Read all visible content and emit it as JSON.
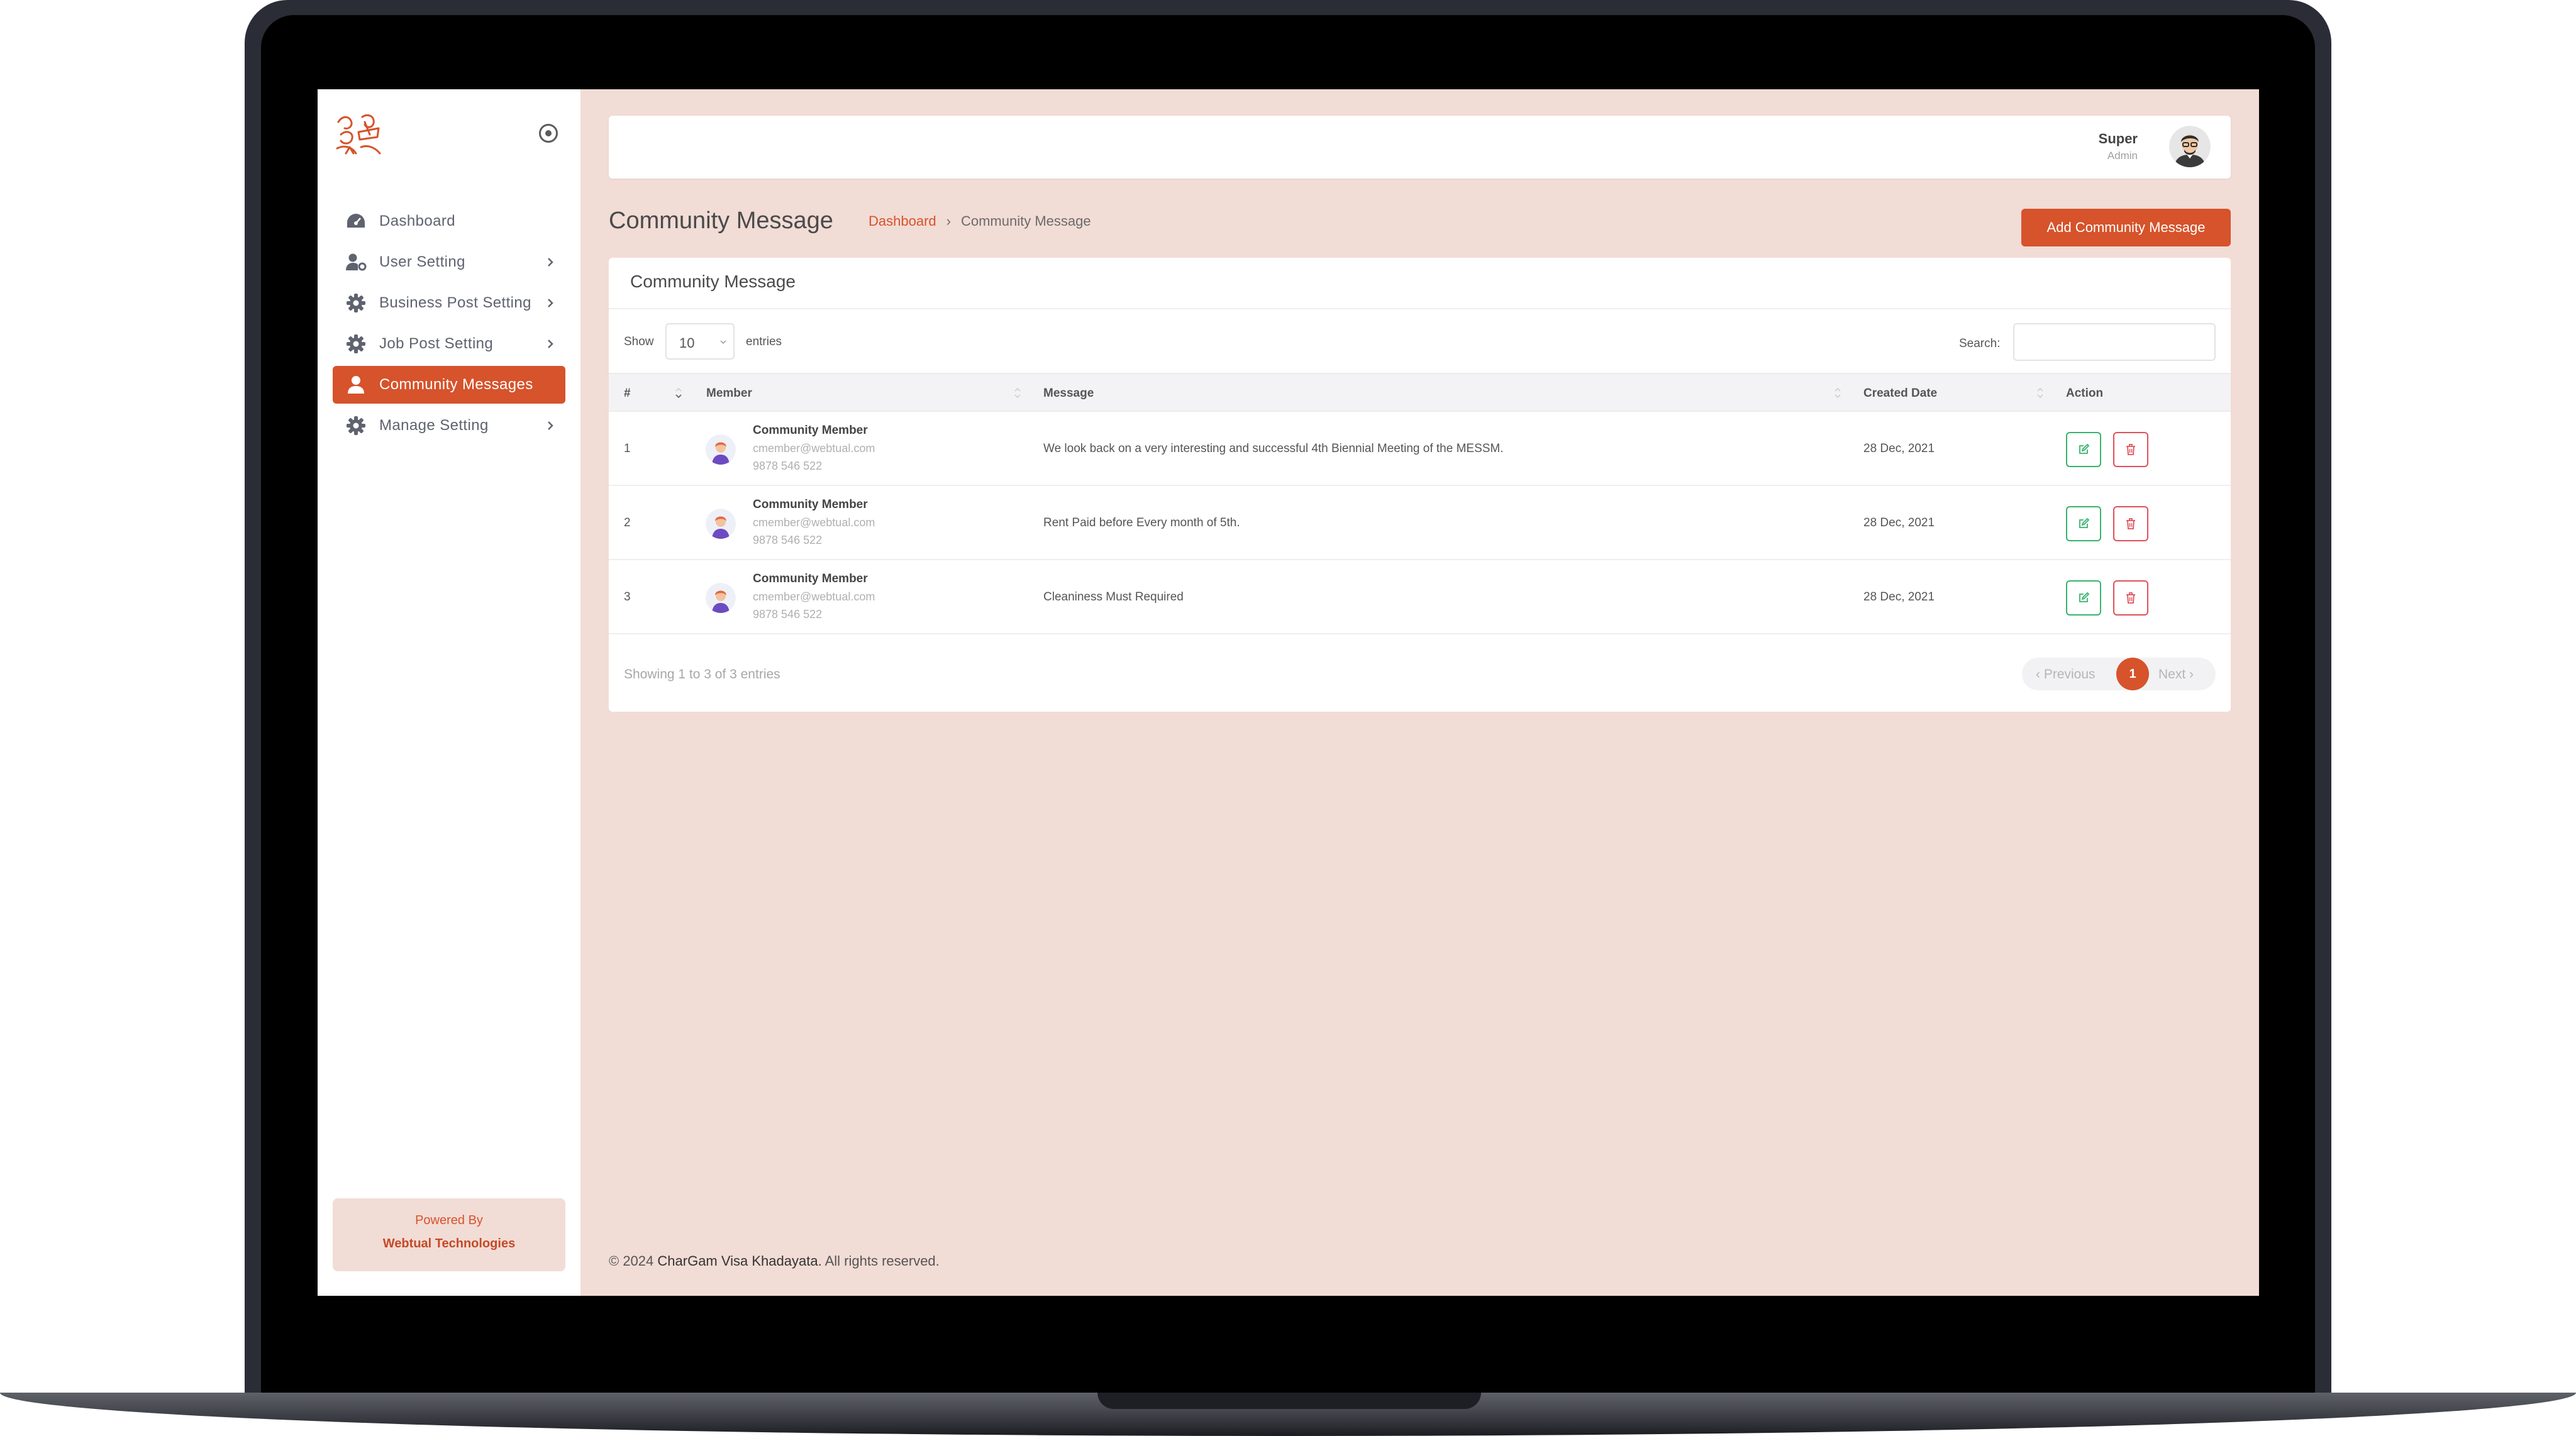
{
  "sidebar": {
    "items": [
      {
        "label": "Dashboard",
        "icon": "dashboard-icon"
      },
      {
        "label": "User Setting",
        "icon": "user-gear-icon"
      },
      {
        "label": "Business Post Setting",
        "icon": "gear-icon"
      },
      {
        "label": "Job Post Setting",
        "icon": "gear-icon"
      },
      {
        "label": "Community Messages",
        "icon": "user-icon",
        "active": true
      },
      {
        "label": "Manage Setting",
        "icon": "gear-icon"
      }
    ],
    "powered_by": "Powered By",
    "company": "Webtual Technologies"
  },
  "header": {
    "user_name": "Super",
    "user_role": "Admin"
  },
  "page": {
    "title": "Community Message",
    "breadcrumb": [
      "Dashboard",
      "Community Message"
    ],
    "add_button": "Add Community Message"
  },
  "card": {
    "title": "Community Message",
    "show_label": "Show",
    "page_length": "10",
    "entries_label": "entries",
    "search_label": "Search:",
    "columns": [
      "#",
      "Member",
      "Message",
      "Created Date",
      "Action"
    ],
    "rows": [
      {
        "index": "1",
        "name": "Community Member",
        "email": "cmember@webtual.com",
        "phone": "9878 546 522",
        "message": "We look back on a very interesting and successful 4th Biennial Meeting of the MESSM.",
        "date": "28 Dec, 2021"
      },
      {
        "index": "2",
        "name": "Community Member",
        "email": "cmember@webtual.com",
        "phone": "9878 546 522",
        "message": "Rent Paid before Every month of 5th.",
        "date": "28 Dec, 2021"
      },
      {
        "index": "3",
        "name": "Community Member",
        "email": "cmember@webtual.com",
        "phone": "9878 546 522",
        "message": "Cleaniness Must Required",
        "date": "28 Dec, 2021"
      }
    ],
    "info": "Showing 1 to 3 of 3 entries",
    "pagination": {
      "prev": "‹ Previous",
      "current": "1",
      "next": "Next ›"
    }
  },
  "footer": {
    "prefix": "© 2024",
    "brand": "CharGam Visa Khadayata.",
    "suffix": "All rights reserved."
  },
  "colors": {
    "accent": "#d6532b",
    "background": "#f2dcd6",
    "edit": "#36b36c",
    "delete": "#e0505a"
  }
}
